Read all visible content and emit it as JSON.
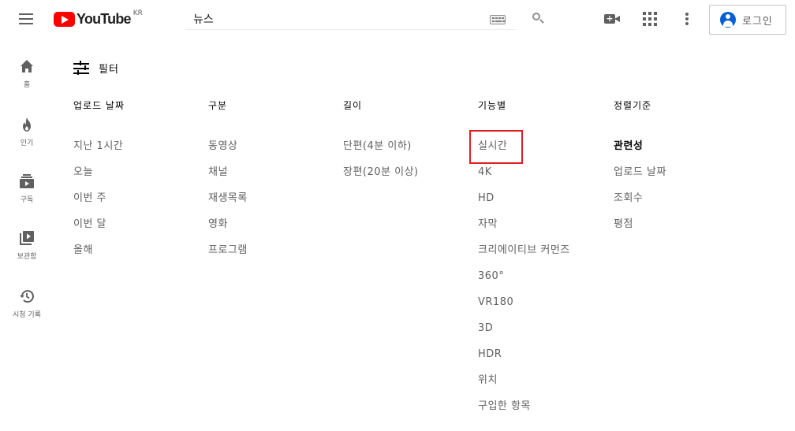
{
  "header": {
    "logo_text": "YouTube",
    "region": "KR",
    "search_value": "뉴스",
    "login_label": "로그인"
  },
  "sidebar": {
    "items": [
      {
        "label": "홈",
        "icon": "home-icon"
      },
      {
        "label": "인기",
        "icon": "fire-icon"
      },
      {
        "label": "구독",
        "icon": "subscriptions-icon"
      },
      {
        "label": "보관함",
        "icon": "library-icon"
      },
      {
        "label": "시청 기록",
        "icon": "history-icon"
      }
    ]
  },
  "filter": {
    "label": "필터",
    "columns": [
      {
        "title": "업로드 날짜",
        "items": [
          "지난 1시간",
          "오늘",
          "이번 주",
          "이번 달",
          "올해"
        ]
      },
      {
        "title": "구분",
        "items": [
          "동영상",
          "채널",
          "재생목록",
          "영화",
          "프로그램"
        ]
      },
      {
        "title": "길이",
        "items": [
          "단편(4분 이하)",
          "장편(20분 이상)"
        ]
      },
      {
        "title": "기능별",
        "items": [
          "실시간",
          "4K",
          "HD",
          "자막",
          "크리에이티브 커먼즈",
          "360°",
          "VR180",
          "3D",
          "HDR",
          "위치",
          "구입한 항목"
        ]
      },
      {
        "title": "정렬기준",
        "items": [
          "관련성",
          "업로드 날짜",
          "조회수",
          "평점"
        ]
      }
    ],
    "selected_sort": "관련성",
    "highlighted_option": "실시간"
  },
  "colors": {
    "brand_red": "#ff0000",
    "highlight_box": "#e02020",
    "login_blue": "#065fd4",
    "muted_text": "#606060"
  }
}
